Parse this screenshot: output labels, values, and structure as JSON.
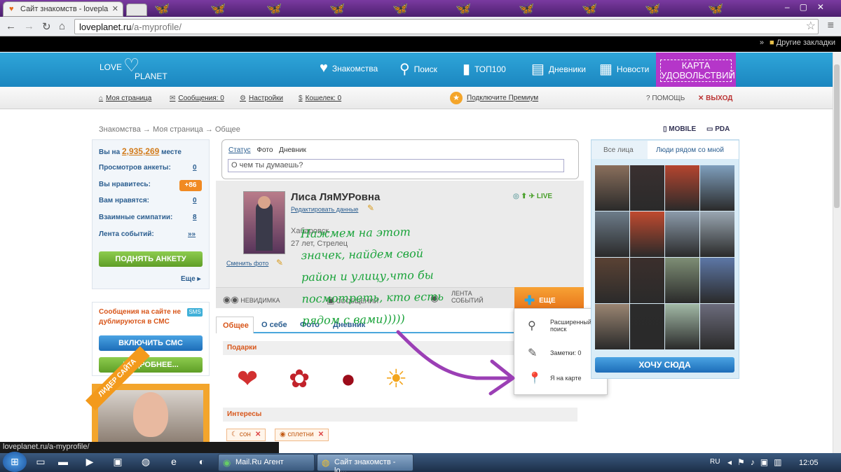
{
  "browser": {
    "tab_title": "Сайт знакомств - lovepla",
    "tab_close": "✕",
    "url_host": "loveplanet.ru",
    "url_path": "/a-myprofile/",
    "bookmark_other": "Другие закладки",
    "bookmark_arrow": "»",
    "window_controls": "–▢✕"
  },
  "site": {
    "logo_line1": "LOVE",
    "logo_line2": "PLANET",
    "nav": [
      {
        "label": "Знакомства",
        "icon": "heart-icon"
      },
      {
        "label": "Поиск",
        "icon": "magnifier-icon"
      },
      {
        "label": "ТОП100",
        "icon": "bar-chart-icon"
      },
      {
        "label": "Дневники",
        "icon": "diary-icon"
      },
      {
        "label": "Новости",
        "icon": "news-icon"
      }
    ],
    "karta_line1": "КАРТА",
    "karta_line2": "УДОВОЛЬСТВИЙ"
  },
  "subbar": {
    "my_page": "Моя страница",
    "messages": "Сообщения: 0",
    "settings": "Настройки",
    "wallet": "Кошелек: 0",
    "premium": "Подключите Премиум",
    "help": "? ПОМОЩЬ",
    "exit": "✕ ВЫХОД"
  },
  "breadcrumb": "Знакомства → Моя страница → Общее",
  "versions": {
    "mobile": "MOBILE",
    "pda": "PDA"
  },
  "left": {
    "rank_prefix": "Вы на",
    "rank_value": "2,935,269",
    "rank_suffix": "месте",
    "stats": [
      {
        "label": "Просмотров анкеты:",
        "value": "0"
      },
      {
        "label": "Вы нравитесь:",
        "value": "+86"
      },
      {
        "label": "Вам нравятся:",
        "value": "0"
      },
      {
        "label": "Взаимные симпатии:",
        "value": "8"
      },
      {
        "label": "Лента событий:",
        "value": "»»"
      }
    ],
    "raise_button": "ПОДНЯТЬ АНКЕТУ",
    "more_link": "Еще ▸",
    "sms_text": "Сообщения на сайте не дублируются в СМС",
    "sms_badge": "SMS",
    "sms_button": "ВКЛЮЧИТЬ СМС",
    "details_button": "ПОДРОБНЕЕ...",
    "leader_ribbon": "ЛИДЕР САЙТА"
  },
  "status": {
    "tab_status": "Статус",
    "tab_photo": "Фото",
    "tab_diary": "Дневник",
    "placeholder": "О чем ты думаешь?"
  },
  "profile": {
    "name": "Лиса ЛяМУРовна",
    "edit_link": "Редактировать данные",
    "city": "Хабаровск",
    "age": "27 лет, Стрелец",
    "change_photo": "Сменить фото",
    "live": "LIVE"
  },
  "actions": {
    "invisible": "НЕВИДИМКА",
    "messages": "СООБЩЕНИЙ",
    "events_l1": "ЛЕНТА",
    "events_l2": "СОБЫТИЙ",
    "more": "ЕЩЕ"
  },
  "profile_tabs": [
    "Общее",
    "О себе",
    "Фото",
    "Дневник"
  ],
  "sections": {
    "gifts": "Подарки",
    "interests": "Интересы"
  },
  "interests": [
    "сон",
    "сплетни"
  ],
  "dropdown": {
    "adv_search_l1": "Расширенный",
    "adv_search_l2": "поиск",
    "notes": "Заметки: 0",
    "on_map": "Я на карте"
  },
  "annotation": [
    "Нажмем на  этот",
    "значек, найдем свой",
    "район и улицу,что бы",
    "посмотреть, кто есть",
    "рядом с вами)))))"
  ],
  "right": {
    "tab_all": "Все лица",
    "tab_near": "Люди рядом со мной",
    "want_button": "ХОЧУ СЮДА",
    "photo_colors": [
      "#8a6f5c",
      "#3a3030",
      "#b5452f",
      "#7f9fbd",
      "#6d7c8a",
      "#c04a2f",
      "#8c9bab",
      "#9aa7b2",
      "#5a4234",
      "#3b2f2c",
      "#7e8e75",
      "#5d77a6",
      "#9a8572",
      "#2b2b2b",
      "#a2b9a6",
      "#6c6c7c"
    ]
  },
  "status_url": "loveplanet.ru/a-myprofile/",
  "taskbar": {
    "mailru": "Mail.Ru Агент",
    "chrome": "Сайт знакомств - lo...",
    "lang": "RU",
    "time": "12:05"
  }
}
